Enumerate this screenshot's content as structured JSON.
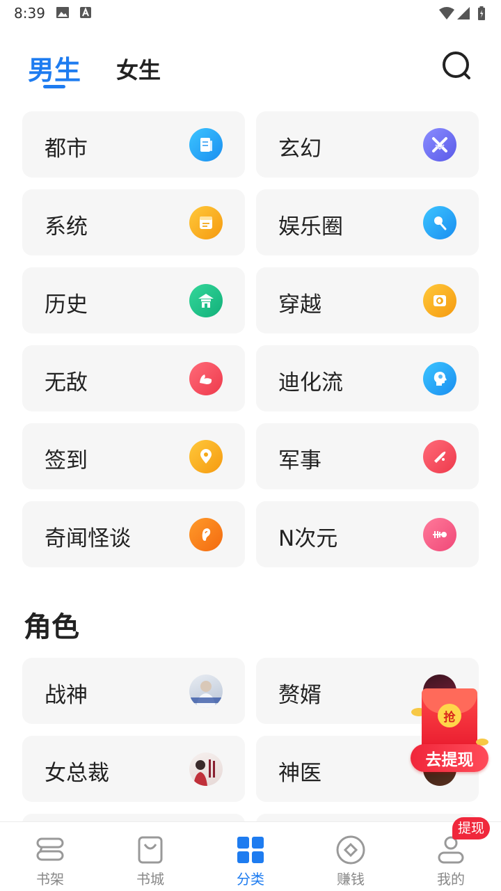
{
  "status_bar": {
    "time": "8:39"
  },
  "header": {
    "tabs": [
      {
        "label": "男生",
        "active": true
      },
      {
        "label": "女生",
        "active": false
      }
    ],
    "search_icon": "search-icon",
    "accent_color": "#1e7cf0"
  },
  "genres": [
    {
      "label": "都市",
      "icon": "newspaper-icon",
      "color": "#1aa0f0"
    },
    {
      "label": "玄幻",
      "icon": "crossed-swords-icon",
      "color": "#6c6cf0"
    },
    {
      "label": "系统",
      "icon": "note-icon",
      "color": "#f7a81a"
    },
    {
      "label": "娱乐圈",
      "icon": "microphone-icon",
      "color": "#1aa0f0"
    },
    {
      "label": "历史",
      "icon": "temple-icon",
      "color": "#1fc08a"
    },
    {
      "label": "穿越",
      "icon": "portal-icon",
      "color": "#f7a81a"
    },
    {
      "label": "无敌",
      "icon": "muscle-icon",
      "color": "#f04a5a"
    },
    {
      "label": "迪化流",
      "icon": "head-icon",
      "color": "#1aa0f0"
    },
    {
      "label": "签到",
      "icon": "location-pin-icon",
      "color": "#f7a81a"
    },
    {
      "label": "军事",
      "icon": "bullet-icon",
      "color": "#f04a5a"
    },
    {
      "label": "奇闻怪谈",
      "icon": "ear-icon",
      "color": "#f57c14"
    },
    {
      "label": "N次元",
      "icon": "fish-bone-icon",
      "color": "#f5507a"
    }
  ],
  "roles_section": {
    "title": "角色",
    "items": [
      {
        "label": "战神"
      },
      {
        "label": "赘婿"
      },
      {
        "label": "女总裁"
      },
      {
        "label": "神医"
      }
    ]
  },
  "promo": {
    "envelope_char": "抢",
    "button_label": "去提现"
  },
  "bottom_nav": {
    "items": [
      {
        "label": "书架",
        "icon": "bookshelf-icon",
        "active": false
      },
      {
        "label": "书城",
        "icon": "shopping-bag-icon",
        "active": false
      },
      {
        "label": "分类",
        "icon": "category-grid-icon",
        "active": true
      },
      {
        "label": "赚钱",
        "icon": "coin-icon",
        "active": false
      },
      {
        "label": "我的",
        "icon": "profile-icon",
        "active": false
      }
    ],
    "badge": "提现"
  }
}
